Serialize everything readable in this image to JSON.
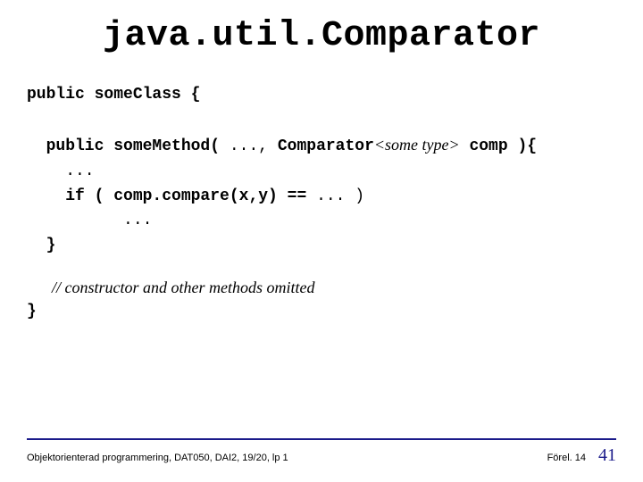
{
  "title": "java.util.Comparator",
  "code": {
    "line1a": "public someClass {",
    "line2_pub": "  public someMethod( ",
    "line2_dots": "..., ",
    "line2_comp": "Comparator",
    "line2_generic": "<some type>",
    "line2_end": " comp ){",
    "line3": "    ...",
    "line4a": "    if ( comp.compare(x,y) == ",
    "line4b": "... )",
    "line5": "          ...",
    "line6": "  }",
    "close": "}"
  },
  "comment": "// constructor and other methods omitted",
  "footer": {
    "left": "Objektorienterad programmering, DAT050, DAI2, 19/20, lp 1",
    "lecture": "Förel. 14",
    "page": "41"
  }
}
